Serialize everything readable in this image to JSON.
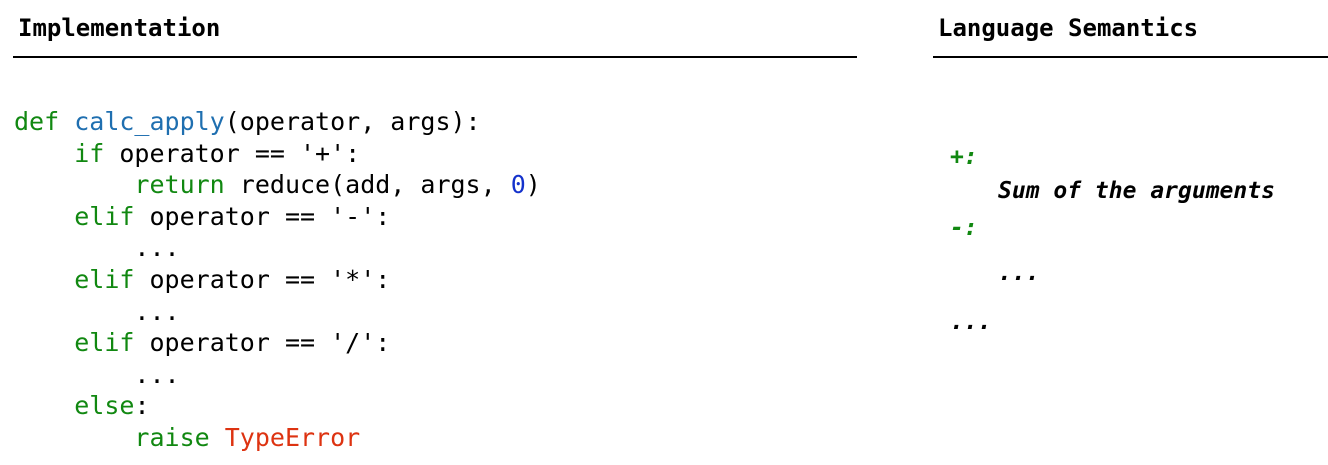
{
  "implementation": {
    "heading": "Implementation",
    "code": {
      "line1": {
        "keyword": "def",
        "function_name": "calc_apply",
        "rest": "(operator, args):"
      },
      "line2": {
        "indent": "    ",
        "keyword": "if",
        "rest": " operator == '+':"
      },
      "line3": {
        "indent": "        ",
        "keyword": "return",
        "rest": " reduce(add, args, ",
        "number": "0",
        "close": ")"
      },
      "line4": {
        "indent": "    ",
        "keyword": "elif",
        "rest": " operator == '-':"
      },
      "line5": {
        "indent": "        ",
        "text": "..."
      },
      "line6": {
        "indent": "    ",
        "keyword": "elif",
        "rest": " operator == '*':"
      },
      "line7": {
        "indent": "        ",
        "text": "..."
      },
      "line8": {
        "indent": "    ",
        "keyword": "elif",
        "rest": " operator == '/':"
      },
      "line9": {
        "indent": "        ",
        "text": "..."
      },
      "line10": {
        "indent": "    ",
        "keyword": "else",
        "rest": ":"
      },
      "line11": {
        "indent": "        ",
        "keyword": "raise",
        "space": " ",
        "exception": "TypeError"
      }
    }
  },
  "semantics": {
    "heading": "Language Semantics",
    "entries": [
      {
        "operator": "+:",
        "description": "Sum of the arguments"
      },
      {
        "operator": "-:",
        "description": "..."
      },
      {
        "operator": "...",
        "description": ""
      }
    ]
  },
  "colors": {
    "keyword": "#118811",
    "function_name": "#1f6fb0",
    "number": "#1432cc",
    "exception": "#dd3311",
    "text": "#000000"
  }
}
